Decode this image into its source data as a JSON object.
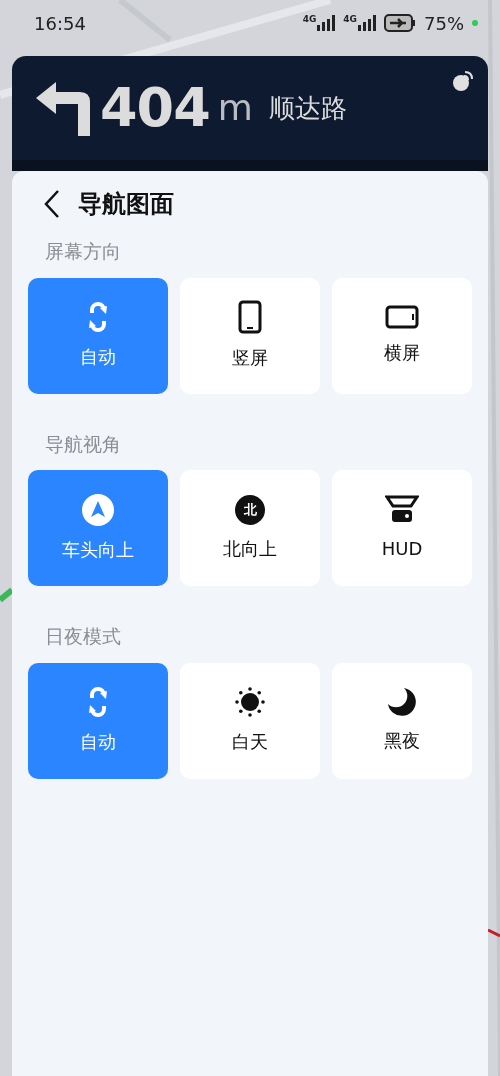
{
  "status_bar": {
    "time": "16:54",
    "signals": [
      "4G",
      "4G"
    ],
    "battery": "75%"
  },
  "guidance": {
    "distance": "404",
    "unit": "m",
    "road": "顺达路"
  },
  "panel": {
    "title": "导航图面"
  },
  "sections": [
    {
      "label": "屏幕方向",
      "options": [
        {
          "kind": "auto",
          "label": "自动",
          "selected": true
        },
        {
          "kind": "portrait",
          "label": "竖屏",
          "selected": false
        },
        {
          "kind": "landscape",
          "label": "横屏",
          "selected": false
        }
      ]
    },
    {
      "label": "导航视角",
      "options": [
        {
          "kind": "heading",
          "label": "车头向上",
          "selected": true
        },
        {
          "kind": "north",
          "label": "北向上",
          "icon_text": "北",
          "selected": false
        },
        {
          "kind": "hud",
          "label": "HUD",
          "selected": false
        }
      ]
    },
    {
      "label": "日夜模式",
      "options": [
        {
          "kind": "auto",
          "label": "自动",
          "selected": true
        },
        {
          "kind": "day",
          "label": "白天",
          "selected": false
        },
        {
          "kind": "night",
          "label": "黑夜",
          "selected": false
        }
      ]
    }
  ]
}
